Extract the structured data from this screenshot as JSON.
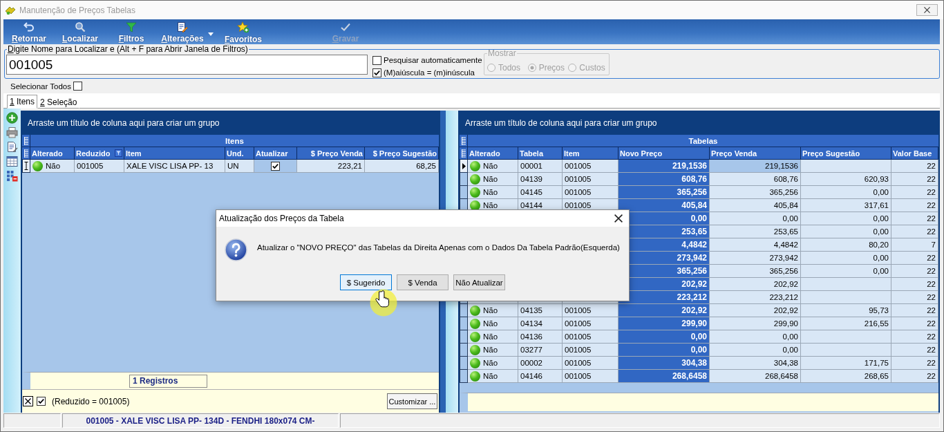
{
  "window": {
    "title": "Manutenção de Preços Tabelas"
  },
  "toolbar": [
    {
      "label": "Retornar",
      "disabled": false,
      "dropdown": false
    },
    {
      "label": "Localizar",
      "disabled": false,
      "dropdown": false
    },
    {
      "label": "Filtros",
      "disabled": false,
      "dropdown": false
    },
    {
      "label": "Alterações",
      "disabled": false,
      "dropdown": true
    },
    {
      "label": "Favoritos",
      "disabled": false,
      "dropdown": false
    },
    {
      "label": "Gravar",
      "disabled": true,
      "dropdown": false
    }
  ],
  "search": {
    "legend": "Digite Nome para Localizar e (Alt + F para Abrir Janela de Filtros)",
    "value": "001005"
  },
  "search_options": [
    {
      "label": "Pesquisar automaticamente",
      "checked": false
    },
    {
      "label": "(M)aiúscula = (m)inúscula",
      "checked": true
    }
  ],
  "show": {
    "legend": "Mostrar",
    "disabled": true,
    "options": [
      {
        "label": "Todos",
        "selected": false
      },
      {
        "label": "Preços",
        "selected": true
      },
      {
        "label": "Custos",
        "selected": false
      }
    ]
  },
  "select_all": {
    "label": "Selecionar Todos",
    "checked": false
  },
  "tabs": [
    {
      "label": "1 Itens",
      "selected": true
    },
    {
      "label": "2 Seleção",
      "selected": false
    }
  ],
  "left_grid": {
    "group_hint": "Arraste um título de coluna aqui para criar um grupo",
    "band": "Itens",
    "edit_mode": true,
    "columns": [
      {
        "label": "Alterado",
        "kind": "status"
      },
      {
        "label": "Reduzido",
        "kind": "text",
        "filtered": true
      },
      {
        "label": "Item",
        "kind": "text"
      },
      {
        "label": "Und.",
        "kind": "text"
      },
      {
        "label": "Atualizar",
        "kind": "check",
        "focused": true
      },
      {
        "label": "$ Preço Venda",
        "kind": "number"
      },
      {
        "label": "$ Preço Sugestão",
        "kind": "number"
      }
    ],
    "rows": [
      {
        "current": true,
        "cells": [
          "Não",
          "001005",
          "XALE VISC LISA PP- 13",
          "UN",
          true,
          "223,21",
          "68,25"
        ]
      }
    ],
    "footer": "1 Registros",
    "filter": {
      "active": true,
      "text": "(Reduzido = 001005)",
      "button": "Customizar ..."
    }
  },
  "right_grid": {
    "group_hint": "Arraste um título de coluna aqui para criar um grupo",
    "band": "Tabelas",
    "edit_mode": false,
    "columns": [
      {
        "label": "Alterado",
        "kind": "status"
      },
      {
        "label": "Tabela",
        "kind": "text"
      },
      {
        "label": "Item",
        "kind": "text"
      },
      {
        "label": "Novo Preço",
        "kind": "number",
        "emphasized": true
      },
      {
        "label": "Preço Venda",
        "kind": "number",
        "focused": true
      },
      {
        "label": "Preço Sugestão",
        "kind": "number"
      },
      {
        "label": "Valor Base",
        "kind": "number"
      }
    ],
    "rows": [
      {
        "current": true,
        "cells": [
          "Não",
          "00001",
          "001005",
          "219,1536",
          "219,1536",
          null,
          "22"
        ]
      },
      {
        "current": false,
        "cells": [
          "Não",
          "04139",
          "001005",
          "608,76",
          "608,76",
          "620,93",
          "22"
        ]
      },
      {
        "current": false,
        "cells": [
          "Não",
          "04145",
          "001005",
          "365,256",
          "365,256",
          "0,00",
          "22"
        ]
      },
      {
        "current": false,
        "cells": [
          "Não",
          "04144",
          "001005",
          "405,84",
          "405,84",
          "317,61",
          "22"
        ]
      },
      {
        "cells": [
          null,
          null,
          null,
          "0,00",
          "0,00",
          "0,00",
          "22"
        ]
      },
      {
        "cells": [
          null,
          null,
          null,
          "253,65",
          "253,65",
          "0,00",
          "22"
        ]
      },
      {
        "cells": [
          null,
          null,
          null,
          "4,4842",
          "4,4842",
          "80,20",
          "7"
        ]
      },
      {
        "cells": [
          null,
          null,
          null,
          "273,942",
          "273,942",
          "0,00",
          "22"
        ]
      },
      {
        "cells": [
          null,
          null,
          null,
          "365,256",
          "365,256",
          "0,00",
          "22"
        ]
      },
      {
        "cells": [
          null,
          null,
          null,
          "202,92",
          "202,92",
          null,
          "22"
        ]
      },
      {
        "cells": [
          null,
          null,
          null,
          "223,212",
          "223,212",
          null,
          "22"
        ]
      },
      {
        "current": false,
        "cells": [
          "Não",
          "04135",
          "001005",
          "202,92",
          "202,92",
          "95,73",
          "22"
        ]
      },
      {
        "current": false,
        "cells": [
          "Não",
          "04134",
          "001005",
          "299,90",
          "299,90",
          "216,55",
          "22"
        ]
      },
      {
        "current": false,
        "cells": [
          "Não",
          "04136",
          "001005",
          "0,00",
          "0,00",
          null,
          "22"
        ]
      },
      {
        "current": false,
        "cells": [
          "Não",
          "03277",
          "001005",
          "0,00",
          "0,00",
          null,
          "22"
        ]
      },
      {
        "current": false,
        "cells": [
          "Não",
          "00002",
          "001005",
          "304,38",
          "304,38",
          "171,75",
          "22"
        ]
      },
      {
        "current": false,
        "cells": [
          "Não",
          "04146",
          "001005",
          "268,6458",
          "268,6458",
          "268,65",
          "22"
        ]
      }
    ]
  },
  "dialog": {
    "title": "Atualização dos Preços da Tabela",
    "message": "Atualizar o \"NOVO PREÇO\" das Tabelas da Direita Apenas com o Dados Da Tabela Padrão(Esquerda)",
    "buttons": [
      {
        "label": "$ Sugerido",
        "default": true
      },
      {
        "label": "$ Venda",
        "default": false
      },
      {
        "label": "Não Atualizar",
        "default": false
      }
    ]
  },
  "status_bar": {
    "text": "001005 - XALE VISC LISA PP- 134D - FENDHI 180x074 CM-"
  }
}
